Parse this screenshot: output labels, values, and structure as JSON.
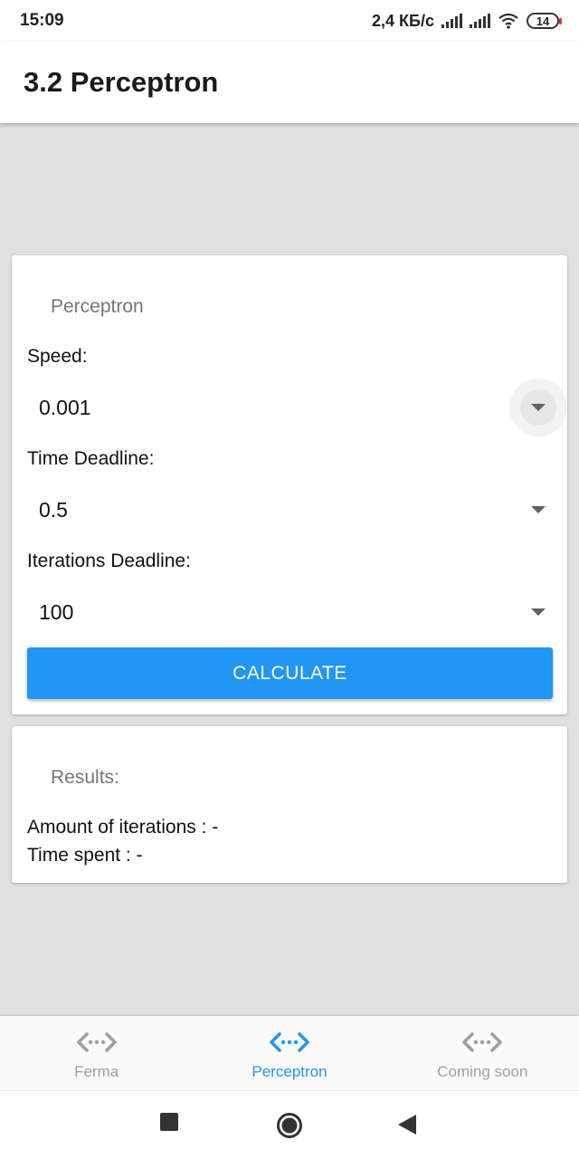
{
  "status": {
    "time": "15:09",
    "network_speed": "2,4 КБ/с",
    "battery_level": "14"
  },
  "app_bar": {
    "title": "3.2 Perceptron"
  },
  "form": {
    "card_title": "Perceptron",
    "speed": {
      "label": "Speed:",
      "value": "0.001"
    },
    "time_deadline": {
      "label": "Time Deadline:",
      "value": "0.5"
    },
    "iterations_deadline": {
      "label": "Iterations Deadline:",
      "value": "100"
    },
    "calculate_label": "CALCULATE"
  },
  "results": {
    "card_title": "Results:",
    "iterations_line": "Amount of iterations : -",
    "time_line": "Time spent : -"
  },
  "bottom_nav": {
    "items": [
      {
        "label": "Ferma",
        "icon": "code-arrows-icon",
        "active": false
      },
      {
        "label": "Perceptron",
        "icon": "code-arrows-icon",
        "active": true
      },
      {
        "label": "Coming soon",
        "icon": "code-arrows-icon",
        "active": false
      }
    ],
    "active_color": "#2196f3",
    "inactive_color": "#9e9e9e"
  },
  "colors": {
    "accent": "#2196f3",
    "background": "#e0e0e0"
  }
}
